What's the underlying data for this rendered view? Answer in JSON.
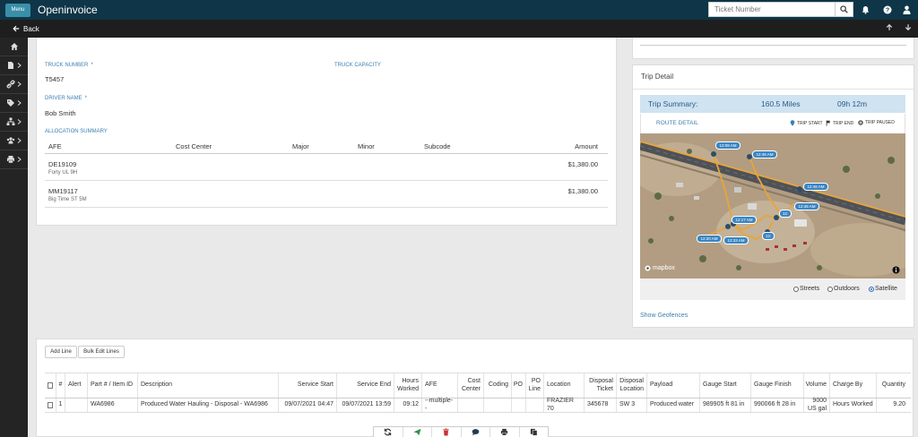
{
  "header": {
    "menu_label": "Menu",
    "app_title": "Openinvoice",
    "search_placeholder": "Ticket Number"
  },
  "backbar": {
    "back_label": "Back"
  },
  "sidebar": {
    "items": [
      {
        "icon": "home-icon"
      },
      {
        "icon": "document-icon"
      },
      {
        "icon": "link-icon"
      },
      {
        "icon": "tag-icon"
      },
      {
        "icon": "sitemap-icon"
      },
      {
        "icon": "users-icon"
      },
      {
        "icon": "print-icon"
      }
    ]
  },
  "ticket": {
    "truck_number_label": "TRUCK NUMBER",
    "truck_number_required": "*",
    "truck_number_value": "T5457",
    "truck_capacity_label": "TRUCK CAPACITY",
    "driver_name_label": "DRIVER NAME",
    "driver_name_required": "*",
    "driver_name_value": "Bob Smith",
    "allocation_label": "ALLOCATION SUMMARY",
    "allocation_columns": [
      "AFE",
      "Cost Center",
      "Major",
      "Minor",
      "Subcode",
      "Amount"
    ],
    "allocation_rows": [
      {
        "afe": "DE19109",
        "afe_sub": "Forty UL 9H",
        "amount": "$1,380.00"
      },
      {
        "afe": "MM19117",
        "afe_sub": "Big Time ST 5M",
        "amount": "$1,380.00"
      }
    ]
  },
  "trip": {
    "title": "Trip Detail",
    "summary_label": "Trip Summary:",
    "distance": "160.5 Miles",
    "duration": "09h 12m",
    "route_detail": "ROUTE DETAIL",
    "legend": {
      "start": "TRIP START",
      "end": "TRIP END",
      "paused": "TRIP PAUSED"
    },
    "map_labels": [
      "12:09 AM",
      "12:46 AM",
      "12:46 AM",
      "12:45 AM",
      "12:17 AM",
      "12:",
      "12:20 AM",
      "12:33 AM",
      "12:"
    ],
    "map_attribution": "mapbox",
    "map_styles": [
      "Streets",
      "Outdoors",
      "Satellite"
    ],
    "selected_style": "Satellite",
    "show_geofences": "Show Geofences"
  },
  "line_items": {
    "add_line": "Add Line",
    "bulk_edit": "Bulk Edit Lines",
    "columns": [
      "#",
      "Alert",
      "Part # / Item ID",
      "Description",
      "Service Start",
      "Service End",
      "Hours Worked",
      "AFE",
      "Cost Center",
      "Coding",
      "PO",
      "PO Line",
      "Location",
      "Disposal Ticket",
      "Disposal Location",
      "Payload",
      "Gauge Start",
      "Gauge Finish",
      "Volume",
      "Charge By",
      "Quantity"
    ],
    "rows": [
      {
        "num": "1",
        "alert": "",
        "part": "WA6986",
        "description": "Produced Water Hauling - Disposal - WA6986",
        "service_start": "09/07/2021 04:47",
        "service_end": "09/07/2021 13:59",
        "hours": "09:12",
        "afe": "--multiple--",
        "cost_center": "",
        "coding": "",
        "po": "",
        "po_line": "",
        "location": "FRAZIER 70",
        "disposal_ticket": "345678",
        "disposal_location": "SW 3",
        "payload": "Produced water",
        "gauge_start": "989905 ft 81 in",
        "gauge_finish": "990066 ft 28 in",
        "volume": "9000 US gal",
        "charge_by": "Hours Worked",
        "quantity": "9.20"
      }
    ]
  },
  "toolbar": {
    "buttons": [
      "refresh-icon",
      "send-icon",
      "trash-icon",
      "comment-icon",
      "print-icon",
      "copy-icon"
    ]
  },
  "colors": {
    "topbar": "#0f3548",
    "accent_blue": "#3b7fb0",
    "trip_summary_bg": "#cfe3f1",
    "delete_red": "#c9302c",
    "send_green": "#2f8f4e"
  }
}
